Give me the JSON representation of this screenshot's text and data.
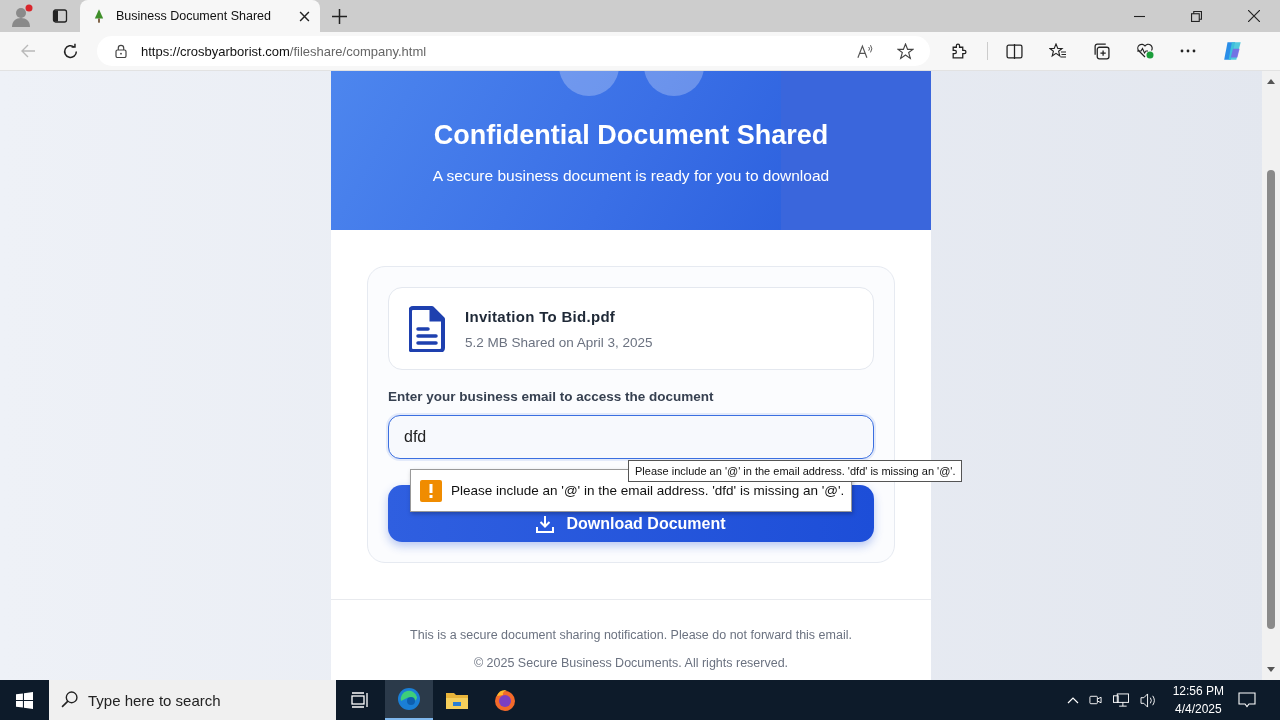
{
  "browser": {
    "tabs": [
      {
        "title": "Business Document Shared",
        "selected": true
      }
    ],
    "url_host": "https://crosbyarborist.com",
    "url_path": "/fileshare/company.html"
  },
  "page": {
    "title": "Confidential Document Shared",
    "subtitle": "A secure business document is ready for you to download",
    "file": {
      "name": "Invitation To Bid.pdf",
      "meta": "5.2 MB Shared on April 3, 2025"
    },
    "email_label": "Enter your business email to access the document",
    "email_value": "dfd",
    "download_button": "Download Document",
    "validation_message": "Please include an '@' in the email address. 'dfd' is missing an '@'.",
    "tooltip": "Please include an '@' in the email address. 'dfd' is missing an '@'.",
    "footer": [
      "This is a secure document sharing notification. Please do not forward this email.",
      "© 2025 Secure Business Documents. All rights reserved."
    ]
  },
  "taskbar": {
    "search_placeholder": "Type here to search",
    "time": "12:56 PM",
    "date": "4/4/2025"
  }
}
